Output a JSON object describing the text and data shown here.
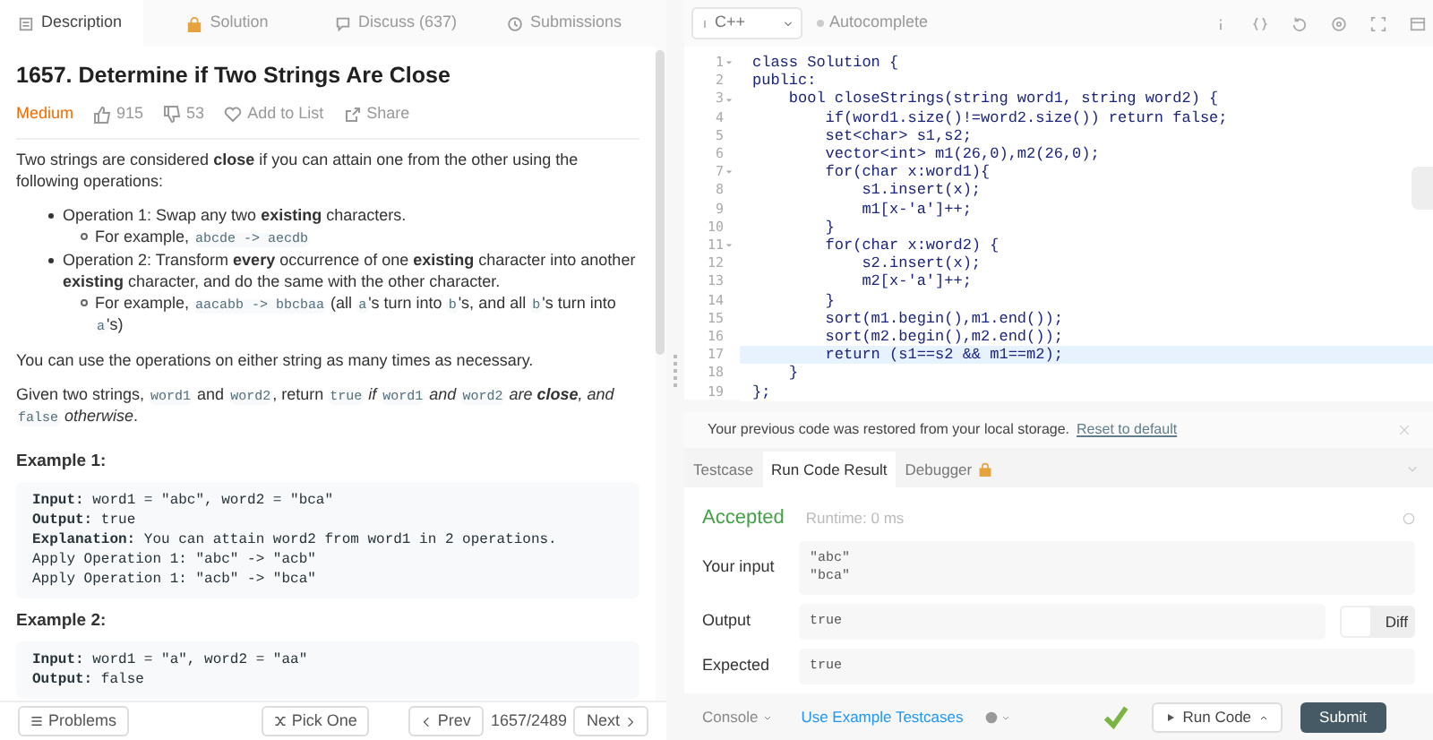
{
  "left_tabs": [
    {
      "label": "Description",
      "selected": true
    },
    {
      "label": "Solution",
      "selected": false
    },
    {
      "label": "Discuss (637)",
      "selected": false
    },
    {
      "label": "Submissions",
      "selected": false
    }
  ],
  "problem": {
    "title": "1657. Determine if Two Strings Are Close",
    "difficulty": "Medium",
    "likes": "915",
    "dislikes": "53",
    "add_to_list": "Add to List",
    "share": "Share"
  },
  "description": [
    {
      "kind": "paragraph",
      "segments": [
        {
          "kind": "text",
          "text": "Two strings are considered **close** if you can attain one from the other using the following operations:"
        }
      ]
    },
    {
      "kind": "bullet",
      "segments": [
        {
          "kind": "text",
          "text": "Operation 1: Swap any two **existing** characters."
        }
      ],
      "children": [
        {
          "segments": [
            {
              "kind": "text",
              "text": "For example, "
            },
            {
              "kind": "code",
              "text": "abcde -> aecdb"
            }
          ]
        }
      ]
    },
    {
      "kind": "bullet",
      "segments": [
        {
          "kind": "text",
          "text": "Operation 2: Transform **every** occurrence of one **existing** character into another **existing** character, and do the same with the other character."
        }
      ],
      "children": [
        {
          "segments": [
            {
              "kind": "text",
              "text": "For example, "
            },
            {
              "kind": "code",
              "text": "aacabb -> bbcbaa"
            },
            {
              "kind": "text",
              "text": " (all "
            },
            {
              "kind": "code",
              "text": "a"
            },
            {
              "kind": "text",
              "text": "'s turn into "
            },
            {
              "kind": "code",
              "text": "b"
            },
            {
              "kind": "text",
              "text": "'s, and all "
            },
            {
              "kind": "code",
              "text": "b"
            },
            {
              "kind": "text",
              "text": "'s turn into "
            },
            {
              "kind": "code",
              "text": "a"
            },
            {
              "kind": "text",
              "text": "'s)"
            }
          ]
        }
      ]
    },
    {
      "kind": "paragraph",
      "segments": [
        {
          "kind": "text",
          "text": "You can use the operations on either string as many times as necessary."
        }
      ]
    },
    {
      "kind": "paragraph",
      "segments": [
        {
          "kind": "text",
          "text": "Given two strings, "
        },
        {
          "kind": "code",
          "text": "word1"
        },
        {
          "kind": "text",
          "text": " and "
        },
        {
          "kind": "code",
          "text": "word2"
        },
        {
          "kind": "text",
          "text": ", return "
        },
        {
          "kind": "code",
          "text": "true"
        },
        {
          "kind": "italic",
          "text": " if "
        },
        {
          "kind": "code",
          "text": "word1"
        },
        {
          "kind": "italic",
          "text": " and "
        },
        {
          "kind": "code",
          "text": "word2"
        },
        {
          "kind": "italic",
          "text": " are **close**, and "
        },
        {
          "kind": "code",
          "text": "false"
        },
        {
          "kind": "italic",
          "text": " otherwise"
        },
        {
          "kind": "text",
          "text": "."
        }
      ]
    }
  ],
  "examples": [
    {
      "heading": "Example 1:",
      "lines": [
        "**Input:** word1 = \"abc\", word2 = \"bca\"",
        "**Output:** true",
        "**Explanation:** You can attain word2 from word1 in 2 operations.",
        "Apply Operation 1: \"abc\" -> \"acb\"",
        "Apply Operation 1: \"acb\" -> \"bca\""
      ]
    },
    {
      "heading": "Example 2:",
      "lines": [
        "**Input:** word1 = \"a\", word2 = \"aa\"",
        "**Output:** false"
      ]
    }
  ],
  "left_footer": {
    "problems": "Problems",
    "pick_one": "Pick One",
    "prev": "Prev",
    "counter": "1657/2489",
    "next": "Next"
  },
  "editor": {
    "language": "C++",
    "autocomplete": "Autocomplete",
    "autocomplete_on": false,
    "lines": [
      {
        "number": "1",
        "text": "class Solution {",
        "foldable": true,
        "highlighted": false
      },
      {
        "number": "2",
        "text": "public:",
        "foldable": false,
        "highlighted": false
      },
      {
        "number": "3",
        "text": "    bool closeStrings(string word1, string word2) {",
        "foldable": true,
        "highlighted": false
      },
      {
        "number": "4",
        "text": "        if(word1.size()!=word2.size()) return false;",
        "foldable": false,
        "highlighted": false
      },
      {
        "number": "5",
        "text": "        set<char> s1,s2;",
        "foldable": false,
        "highlighted": false
      },
      {
        "number": "6",
        "text": "        vector<int> m1(26,0),m2(26,0);",
        "foldable": false,
        "highlighted": false
      },
      {
        "number": "7",
        "text": "        for(char x:word1){",
        "foldable": true,
        "highlighted": false
      },
      {
        "number": "8",
        "text": "            s1.insert(x);",
        "foldable": false,
        "highlighted": false
      },
      {
        "number": "9",
        "text": "            m1[x-'a']++;",
        "foldable": false,
        "highlighted": false
      },
      {
        "number": "10",
        "text": "        }",
        "foldable": false,
        "highlighted": false
      },
      {
        "number": "11",
        "text": "        for(char x:word2) {",
        "foldable": true,
        "highlighted": false
      },
      {
        "number": "12",
        "text": "            s2.insert(x);",
        "foldable": false,
        "highlighted": false
      },
      {
        "number": "13",
        "text": "            m2[x-'a']++;",
        "foldable": false,
        "highlighted": false
      },
      {
        "number": "14",
        "text": "        }",
        "foldable": false,
        "highlighted": false
      },
      {
        "number": "15",
        "text": "        sort(m1.begin(),m1.end());",
        "foldable": false,
        "highlighted": false
      },
      {
        "number": "16",
        "text": "        sort(m2.begin(),m2.end());",
        "foldable": false,
        "highlighted": false
      },
      {
        "number": "17",
        "text": "        return (s1==s2 && m1==m2);",
        "foldable": false,
        "highlighted": true
      },
      {
        "number": "18",
        "text": "    }",
        "foldable": false,
        "highlighted": false
      },
      {
        "number": "19",
        "text": "};",
        "foldable": false,
        "highlighted": false
      }
    ]
  },
  "notice": {
    "text": "Your previous code was restored from your local storage.",
    "link": "Reset to default"
  },
  "result_tabs": [
    {
      "label": "Testcase",
      "selected": false,
      "locked": false
    },
    {
      "label": "Run Code Result",
      "selected": true,
      "locked": false
    },
    {
      "label": "Debugger",
      "selected": false,
      "locked": true
    }
  ],
  "result": {
    "status": "Accepted",
    "runtime": "Runtime: 0 ms",
    "rows": [
      {
        "label": "Your input",
        "lines": [
          "\"abc\"",
          "\"bca\""
        ]
      },
      {
        "label": "Output",
        "lines": [
          "true"
        ],
        "diff": "Diff",
        "diff_on": false
      },
      {
        "label": "Expected",
        "lines": [
          "true"
        ]
      }
    ]
  },
  "right_footer": {
    "console": "Console",
    "example_testcases": "Use Example Testcases",
    "run_code": "Run Code",
    "submit": "Submit"
  }
}
